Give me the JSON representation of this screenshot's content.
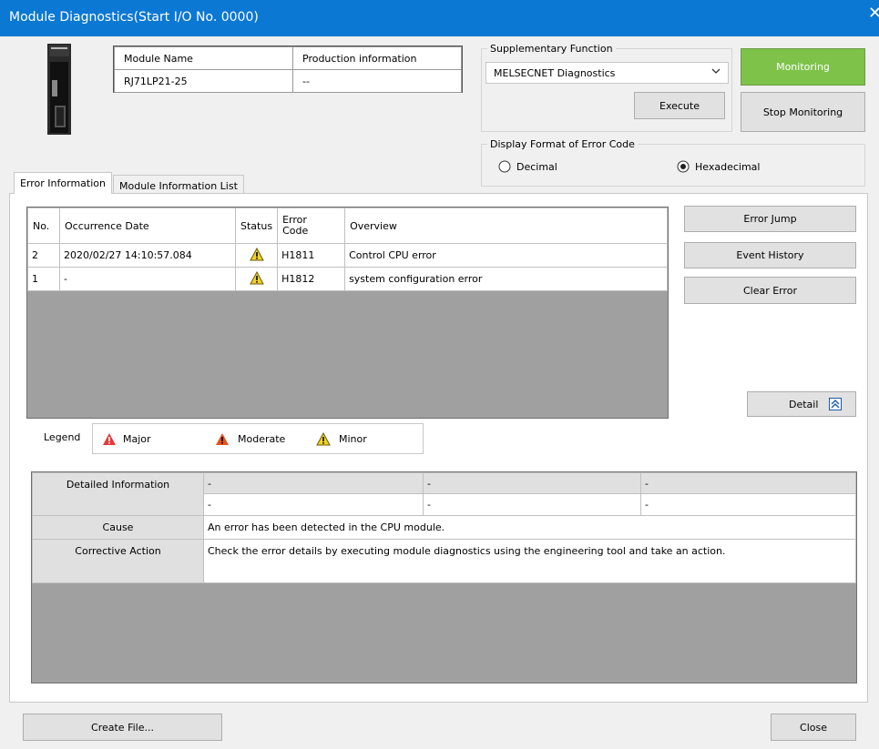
{
  "window": {
    "title": "Module Diagnostics(Start I/O No. 0000)",
    "close_glyph": "✕"
  },
  "module_table": {
    "headers": [
      "Module Name",
      "Production information"
    ],
    "row": [
      "RJ71LP21-25",
      "--"
    ]
  },
  "supplementary": {
    "group_label": "Supplementary Function",
    "select_value": "MELSECNET Diagnostics",
    "execute_label": "Execute"
  },
  "monitoring": {
    "start_label": "Monitoring",
    "stop_label": "Stop Monitoring",
    "active_color": "#7ec24a"
  },
  "error_format": {
    "group_label": "Display Format of Error Code",
    "decimal_label": "Decimal",
    "hex_label": "Hexadecimal",
    "selected": "Hexadecimal"
  },
  "tabs": [
    "Error Information",
    "Module Information List"
  ],
  "error_grid": {
    "headers": {
      "no": "No.",
      "date": "Occurrence Date",
      "status": "Status",
      "code_line1": "Error",
      "code_line2": "Code",
      "overview": "Overview"
    },
    "rows": [
      {
        "no": "2",
        "date": "2020/02/27 14:10:57.084",
        "status": "minor",
        "code": "H1811",
        "overview": "Control CPU error"
      },
      {
        "no": "1",
        "date": "-",
        "status": "minor",
        "code": "H1812",
        "overview": "system configuration error"
      }
    ]
  },
  "side_buttons": {
    "error_jump": "Error Jump",
    "event_history": "Event History",
    "clear_error": "Clear Error",
    "detail": "Detail"
  },
  "legend": {
    "title": "Legend",
    "major": "Major",
    "moderate": "Moderate",
    "minor": "Minor",
    "colors": {
      "major": "#e23b3b",
      "moderate": "#e0541c",
      "minor": "#f2d12b"
    }
  },
  "detail_table": {
    "detailed_information_label": "Detailed Information",
    "detail_row1": [
      "-",
      "-",
      "-"
    ],
    "detail_row2": [
      "-",
      "-",
      "-"
    ],
    "cause_label": "Cause",
    "cause_text": "An error has been detected in the CPU module.",
    "corrective_label": "Corrective Action",
    "corrective_text": "Check the error details by executing module diagnostics using the engineering tool and take an action."
  },
  "footer": {
    "create_file": "Create File...",
    "close": "Close"
  }
}
